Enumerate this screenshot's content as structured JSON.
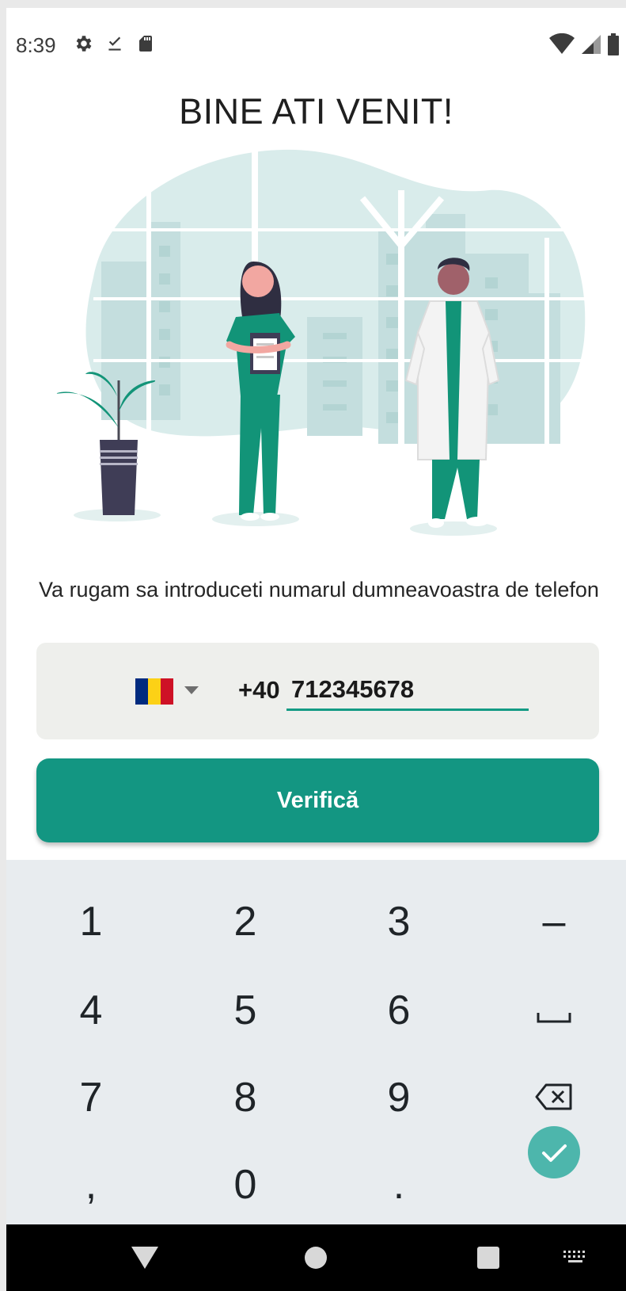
{
  "status_bar": {
    "time": "8:39",
    "left_icons": [
      "settings-icon",
      "download-done-icon",
      "sd-card-icon"
    ],
    "right_icons": [
      "wifi-icon",
      "cell-signal-icon",
      "battery-icon"
    ]
  },
  "title": "BINE ATI VENIT!",
  "instruction": "Va rugam sa introduceti numarul dumneavoastra  de telefon",
  "phone": {
    "country_flag": "romania-flag-icon",
    "flag_colors": [
      "#002B7F",
      "#FCD116",
      "#CE1126"
    ],
    "dial_code": "+40",
    "number": "712345678"
  },
  "verify_label": "Verifică",
  "keyboard": {
    "rows": [
      [
        "1",
        "2",
        "3",
        "–"
      ],
      [
        "4",
        "5",
        "6",
        "space-icon"
      ],
      [
        "7",
        "8",
        "9",
        "backspace-icon"
      ],
      [
        ",",
        "0",
        ".",
        "done-check-icon"
      ]
    ]
  },
  "colors": {
    "accent": "#139682",
    "underline": "#139b84",
    "card_bg": "#eeefec",
    "keyboard_bg": "#e8ecef",
    "done_key": "#4db6ac"
  }
}
